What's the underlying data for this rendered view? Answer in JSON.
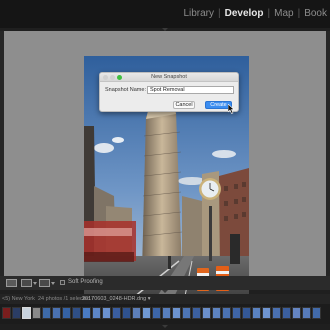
{
  "header": {
    "modules": [
      "Library",
      "Develop",
      "Map",
      "Book"
    ],
    "active_module": "Develop",
    "separator": "|"
  },
  "dialog": {
    "title": "New Snapshot",
    "name_label": "Snapshot Name:",
    "name_value": "Spot Removal",
    "cancel_label": "Cancel",
    "create_label": "Create"
  },
  "toolbar": {
    "soft_proofing_label": "Soft Proofing"
  },
  "filmstrip": {
    "source": "<5) New York",
    "count": "24 photos /1 selected /",
    "filename": "20170603_0248-HDR.dng ▾",
    "thumb_colors": [
      "#7a1e1e",
      "#2b3d64",
      "#c9d3dd",
      "#8a8a8a",
      "#3e6aa8",
      "#4a71b0",
      "#3562a4",
      "#2f4f86",
      "#4a7bc2",
      "#5d86c6",
      "#6b92cf",
      "#3a5ea0",
      "#2f528e",
      "#5d7fb8",
      "#7099d4",
      "#3d66a8",
      "#587fbd",
      "#6d94d0",
      "#4d75b5",
      "#3c609f",
      "#6b8fca",
      "#5e84c1",
      "#4b72b2",
      "#3f65a6",
      "#345896",
      "#5a82c0",
      "#6f95d1",
      "#4a70b0",
      "#3b5f9e",
      "#6585c2",
      "#577bb9",
      "#426aa9"
    ],
    "selected_index": 2
  }
}
